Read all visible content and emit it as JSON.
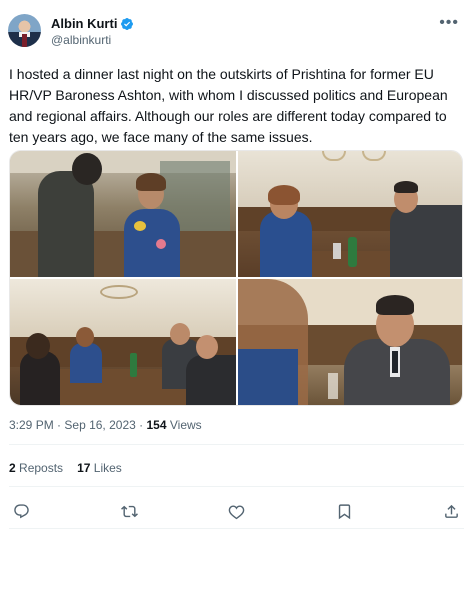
{
  "author": {
    "name": "Albin Kurti",
    "handle": "@albinkurti",
    "verified": true
  },
  "post": {
    "text": "I hosted a dinner last night on the outskirts of Prishtina for former EU HR/VP Baroness Ashton, with whom I discussed politics and European and regional affairs. Although our roles are different today compared to ten years ago, we face many of the same issues.",
    "photos": [
      "dinner-photo-1",
      "dinner-photo-2",
      "dinner-photo-3",
      "dinner-photo-4"
    ]
  },
  "meta": {
    "time": "3:29 PM",
    "separator": "·",
    "date": "Sep 16, 2023",
    "views_count": "154",
    "views_label": "Views"
  },
  "stats": {
    "reposts_count": "2",
    "reposts_label": "Reposts",
    "likes_count": "17",
    "likes_label": "Likes"
  },
  "icons": {
    "reply": "reply-icon",
    "repost": "repost-icon",
    "like": "heart-icon",
    "bookmark": "bookmark-icon",
    "share": "share-icon",
    "more": "more-icon"
  },
  "colors": {
    "verified": "#1d9bf0",
    "secondary_text": "#536471",
    "primary_text": "#0f1419"
  }
}
